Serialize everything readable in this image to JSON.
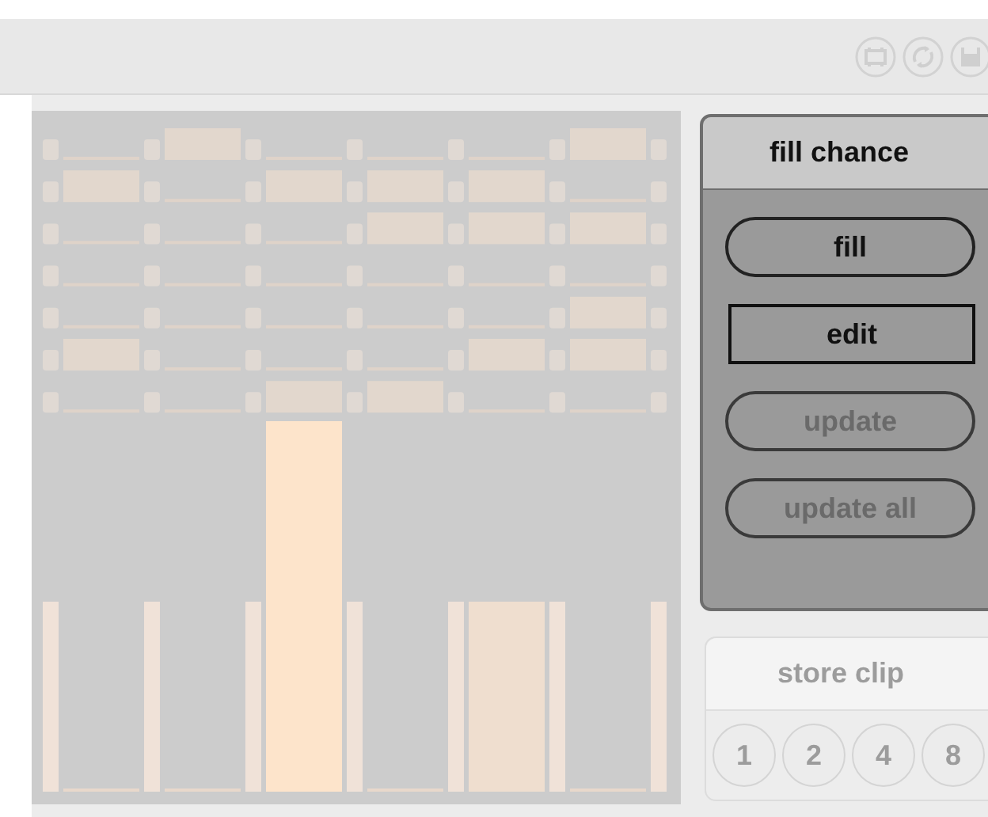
{
  "step_rows": [
    {
      "cells": [
        {
          "on": false
        },
        {
          "on": true
        },
        {
          "on": false
        },
        {
          "on": false
        },
        {
          "on": false
        },
        {
          "on": true
        }
      ]
    },
    {
      "cells": [
        {
          "on": true
        },
        {
          "on": false
        },
        {
          "on": true
        },
        {
          "on": true
        },
        {
          "on": true
        },
        {
          "on": false
        }
      ]
    },
    {
      "cells": [
        {
          "on": false
        },
        {
          "on": false
        },
        {
          "on": false
        },
        {
          "on": true
        },
        {
          "on": true
        },
        {
          "on": true
        }
      ]
    },
    {
      "cells": [
        {
          "on": false
        },
        {
          "on": false
        },
        {
          "on": false
        },
        {
          "on": false
        },
        {
          "on": false
        },
        {
          "on": false
        }
      ]
    },
    {
      "cells": [
        {
          "on": false
        },
        {
          "on": false
        },
        {
          "on": false
        },
        {
          "on": false
        },
        {
          "on": false
        },
        {
          "on": true
        }
      ]
    },
    {
      "cells": [
        {
          "on": true
        },
        {
          "on": false
        },
        {
          "on": false
        },
        {
          "on": false
        },
        {
          "on": true
        },
        {
          "on": true
        }
      ]
    },
    {
      "cells": [
        {
          "on": false
        },
        {
          "on": false
        },
        {
          "on": true
        },
        {
          "on": true
        },
        {
          "on": false
        },
        {
          "on": false
        }
      ]
    }
  ],
  "bars": [
    {
      "kind": "flat"
    },
    {
      "kind": "flat"
    },
    {
      "kind": "tall"
    },
    {
      "kind": "flat"
    },
    {
      "kind": "half"
    },
    {
      "kind": "flat"
    }
  ],
  "fill_chance": {
    "title": "fill chance",
    "buttons": [
      {
        "label": "fill",
        "kind": "pill",
        "disabled": false
      },
      {
        "label": "edit",
        "kind": "box",
        "disabled": false
      },
      {
        "label": "update",
        "kind": "pill",
        "disabled": true
      },
      {
        "label": "update all",
        "kind": "pill",
        "disabled": true
      }
    ]
  },
  "store_clip": {
    "title": "store clip",
    "disabled": true,
    "slots": [
      "1",
      "2",
      "4",
      "8"
    ]
  }
}
